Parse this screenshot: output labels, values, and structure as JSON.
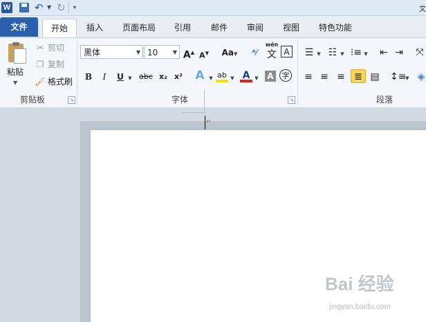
{
  "qat": {
    "app_icon": "W",
    "right_edge": "文"
  },
  "tabs": [
    {
      "label": "文件"
    },
    {
      "label": "开始"
    },
    {
      "label": "插入"
    },
    {
      "label": "页面布局"
    },
    {
      "label": "引用"
    },
    {
      "label": "邮件"
    },
    {
      "label": "审阅"
    },
    {
      "label": "视图"
    },
    {
      "label": "特色功能"
    }
  ],
  "clipboard": {
    "paste_label": "粘贴",
    "cut_label": "剪切",
    "copy_label": "复制",
    "format_painter_label": "格式刷",
    "group_label": "剪贴板"
  },
  "font": {
    "font_name": "黑体",
    "font_size": "10",
    "grow_label": "A",
    "shrink_label": "A",
    "case_label": "Aa",
    "pinyin_top": "wén",
    "pinyin_char": "文",
    "border_char": "A",
    "bold": "B",
    "italic": "I",
    "underline": "U",
    "strike": "abc",
    "subscript": "x₂",
    "superscript": "x²",
    "effects": "A",
    "highlight": "ab",
    "font_color": "A",
    "shading": "A",
    "enclose": "字",
    "group_label": "字体"
  },
  "paragraph": {
    "group_label": "段落"
  },
  "colors": {
    "file_tab": "#2b5fae",
    "highlight_yellow": "#f2e000",
    "font_red": "#e0201c",
    "justify_selected": "#fbd65a"
  },
  "watermark": {
    "main": "Bai 经验",
    "sub": "jingyan.baidu.com"
  }
}
